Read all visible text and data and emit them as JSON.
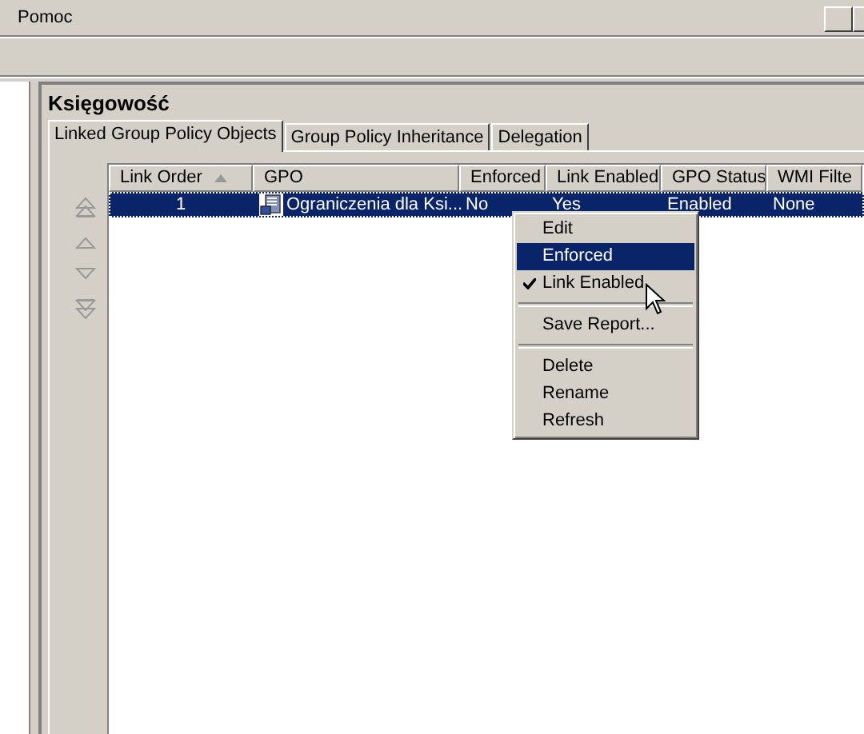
{
  "menubar": {
    "items": [
      "Pomoc"
    ]
  },
  "panel": {
    "title": "Księgowość"
  },
  "tabs": [
    {
      "label": "Linked Group Policy Objects",
      "selected": true
    },
    {
      "label": "Group Policy Inheritance",
      "selected": false
    },
    {
      "label": "Delegation",
      "selected": false
    }
  ],
  "table": {
    "columns": [
      {
        "label": "Link Order",
        "sorted": true
      },
      {
        "label": "GPO"
      },
      {
        "label": "Enforced"
      },
      {
        "label": "Link Enabled"
      },
      {
        "label": "GPO Status"
      },
      {
        "label": "WMI Filte"
      }
    ],
    "rows": [
      {
        "selected": true,
        "cells": [
          "1",
          "Ograniczenia dla Ksi...",
          "No",
          "Yes",
          "Enabled",
          "None"
        ]
      }
    ]
  },
  "context_menu": {
    "items": [
      {
        "kind": "item",
        "label": "Edit",
        "selected": false,
        "checked": false
      },
      {
        "kind": "item",
        "label": "Enforced",
        "selected": true,
        "checked": false
      },
      {
        "kind": "item",
        "label": "Link Enabled",
        "selected": false,
        "checked": true
      },
      {
        "kind": "separator"
      },
      {
        "kind": "item",
        "label": "Save Report...",
        "selected": false,
        "checked": false
      },
      {
        "kind": "separator"
      },
      {
        "kind": "item",
        "label": "Delete",
        "selected": false,
        "checked": false
      },
      {
        "kind": "item",
        "label": "Rename",
        "selected": false,
        "checked": false
      },
      {
        "kind": "item",
        "label": "Refresh",
        "selected": false,
        "checked": false
      }
    ]
  }
}
